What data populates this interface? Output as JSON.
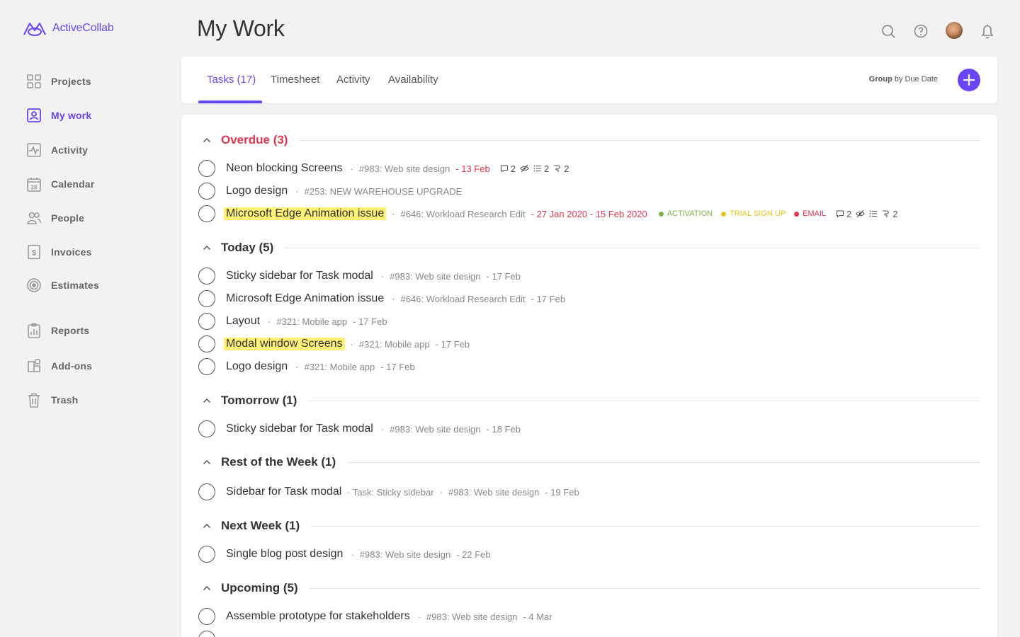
{
  "app": {
    "name": "ActiveCollab",
    "accent": "#6a45f5"
  },
  "sidebar": {
    "items": [
      {
        "label": "Projects",
        "icon": "grid-icon",
        "active": false
      },
      {
        "label": "My work",
        "icon": "user-badge-icon",
        "active": true
      },
      {
        "label": "Activity",
        "icon": "activity-icon",
        "active": false
      },
      {
        "label": "Calendar",
        "icon": "calendar-icon",
        "active": false
      },
      {
        "label": "People",
        "icon": "people-icon",
        "active": false
      },
      {
        "label": "Invoices",
        "icon": "invoice-icon",
        "active": false
      },
      {
        "label": "Estimates",
        "icon": "target-icon",
        "active": false
      },
      {
        "label": "Reports",
        "icon": "reports-icon",
        "active": false
      },
      {
        "label": "Add-ons",
        "icon": "addons-icon",
        "active": false
      },
      {
        "label": "Trash",
        "icon": "trash-icon",
        "active": false
      }
    ],
    "calendar_day": "28"
  },
  "header": {
    "title": "My Work",
    "icons": [
      "search-icon",
      "help-icon",
      "avatar",
      "bell-icon"
    ]
  },
  "tabs": {
    "items": [
      "Tasks (17)",
      "Timesheet",
      "Activity",
      "Availability"
    ],
    "active_index": 0,
    "group_by_bold": "Group",
    "group_by_rest": " by Due Date"
  },
  "groups": [
    {
      "title": "Overdue (3)",
      "overdue": true,
      "tasks": [
        {
          "name": "Neon blocking Screens",
          "highlight": false,
          "meta": "#983: Web site design",
          "date": "- 13 Feb",
          "date_red": true,
          "stats": {
            "comments": "2",
            "hidden": true,
            "subtasks": "2",
            "attachments": "2"
          }
        },
        {
          "name": "Logo design",
          "highlight": false,
          "meta": "#253: NEW WAREHOUSE UPGRADE",
          "date": "",
          "date_red": false
        },
        {
          "name": "Microsoft Edge Animation issue",
          "highlight": true,
          "meta": "#646: Workload Research Edit",
          "date": "- 27 Jan 2020 - 15 Feb 2020",
          "date_red": true,
          "labels": [
            {
              "text": "ACTIVATION",
              "color": "#7cb342"
            },
            {
              "text": "TRIAL SIGN UP",
              "color": "#e6c619"
            },
            {
              "text": "EMAIL",
              "color": "#e0364f"
            }
          ],
          "stats": {
            "comments": "2",
            "hidden": true,
            "subtasks": "",
            "attachments": "2"
          }
        }
      ]
    },
    {
      "title": "Today (5)",
      "overdue": false,
      "tasks": [
        {
          "name": "Sticky sidebar for Task modal",
          "highlight": false,
          "meta": "#983: Web site design",
          "date": "- 17 Feb"
        },
        {
          "name": "Microsoft Edge Animation issue",
          "highlight": false,
          "meta": "#646: Workload Research Edit",
          "date": "- 17 Feb"
        },
        {
          "name": "Layout",
          "highlight": false,
          "meta": "#321: Mobile app",
          "date": "- 17 Feb"
        },
        {
          "name": "Modal window Screens",
          "highlight": true,
          "meta": "#321: Mobile app",
          "date": "- 17 Feb"
        },
        {
          "name": "Logo design",
          "highlight": false,
          "meta": "#321: Mobile app",
          "date": "- 17 Feb"
        }
      ]
    },
    {
      "title": "Tomorrow (1)",
      "overdue": false,
      "tasks": [
        {
          "name": "Sticky sidebar for Task modal",
          "highlight": false,
          "meta": "#983: Web site design",
          "date": "- 18 Feb"
        }
      ]
    },
    {
      "title": "Rest of the Week (1)",
      "overdue": false,
      "tasks": [
        {
          "name": "Sidebar for Task modal",
          "highlight": false,
          "parent": "Task: Sticky sidebar",
          "meta": "#983: Web site design",
          "date": "- 19 Feb"
        }
      ]
    },
    {
      "title": "Next Week (1)",
      "overdue": false,
      "tasks": [
        {
          "name": "Single blog post design",
          "highlight": false,
          "meta": "#983: Web site design",
          "date": "- 22 Feb"
        }
      ]
    },
    {
      "title": "Upcoming (5)",
      "overdue": false,
      "tasks": [
        {
          "name": "Assemble prototype for stakeholders",
          "highlight": false,
          "meta": "#983: Web site design",
          "date": "- 4 Mar"
        }
      ]
    }
  ]
}
